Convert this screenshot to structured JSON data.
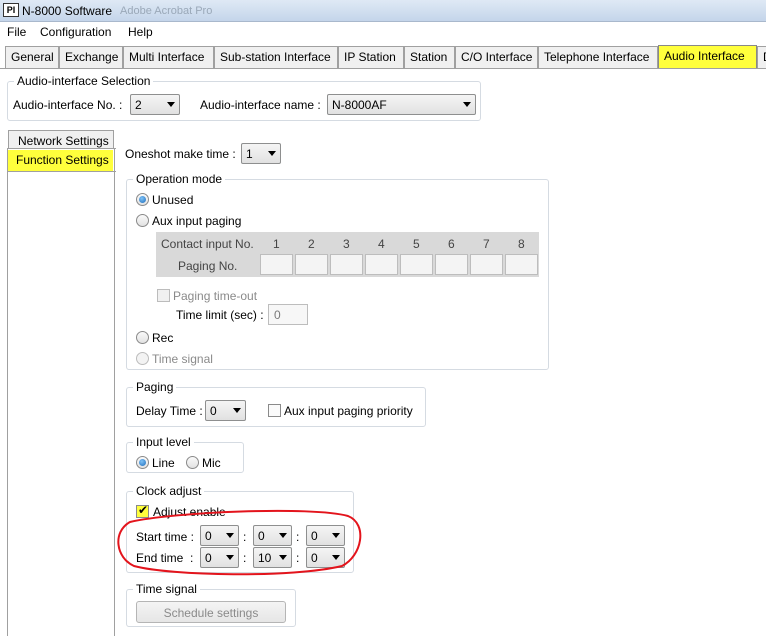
{
  "window": {
    "icon_text": "PI",
    "title": "N-8000 Software",
    "ghost_text": "Adobe Acrobat Pro"
  },
  "menu": [
    "File",
    "Configuration",
    "Help"
  ],
  "tabs": [
    {
      "label": "General",
      "active": false
    },
    {
      "label": "Exchange",
      "active": false
    },
    {
      "label": "Multi Interface",
      "active": false
    },
    {
      "label": "Sub-station Interface",
      "active": false
    },
    {
      "label": "IP Station",
      "active": false
    },
    {
      "label": "Station",
      "active": false
    },
    {
      "label": "C/O Interface",
      "active": false
    },
    {
      "label": "Telephone Interface",
      "active": false
    },
    {
      "label": "Audio Interface",
      "active": true
    },
    {
      "label": "D",
      "active": false
    }
  ],
  "selection": {
    "legend": "Audio-interface Selection",
    "no_label": "Audio-interface No. :",
    "no_value": "2",
    "name_label": "Audio-interface name :",
    "name_value": "N-8000AF"
  },
  "subtabs": {
    "network": "Network Settings",
    "function": "Function Settings"
  },
  "oneshot": {
    "label": "Oneshot make time :",
    "value": "1"
  },
  "operation_mode": {
    "legend": "Operation mode",
    "unused": "Unused",
    "aux_input_paging": "Aux input paging",
    "contact_input_label": "Contact input No.",
    "paging_no_label": "Paging No.",
    "columns": [
      "1",
      "2",
      "3",
      "4",
      "5",
      "6",
      "7",
      "8"
    ],
    "paging_timeout": "Paging time-out",
    "time_limit_label": "Time limit (sec) :",
    "time_limit_value": "0",
    "rec": "Rec",
    "time_signal": "Time signal",
    "selected": "Unused"
  },
  "paging": {
    "legend": "Paging",
    "delay_label": "Delay Time :",
    "delay_value": "0",
    "aux_priority": "Aux input paging priority"
  },
  "input_level": {
    "legend": "Input level",
    "line": "Line",
    "mic": "Mic",
    "selected": "Line"
  },
  "clock_adjust": {
    "legend": "Clock adjust",
    "adjust_enable": "Adjust enable",
    "start_label": "Start time :",
    "end_label": "End time  :",
    "start": [
      "0",
      "0",
      "0"
    ],
    "end": [
      "0",
      "10",
      "0"
    ],
    "separator": ":"
  },
  "time_signal": {
    "legend": "Time signal",
    "schedule_button": "Schedule settings"
  },
  "colors": {
    "highlight": "#ffff3c",
    "annotation": "#e3141c"
  }
}
